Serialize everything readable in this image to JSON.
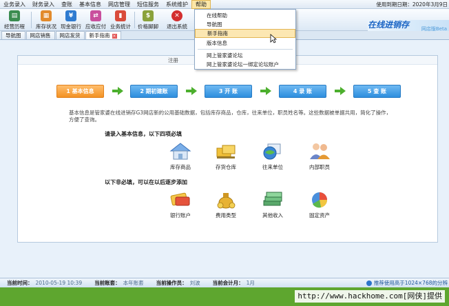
{
  "menu": {
    "items": [
      "业务录入",
      "财务录入",
      "查账",
      "基本信息",
      "网店管理",
      "短信服务",
      "系统维护",
      "帮助"
    ],
    "active_index": 7,
    "expiry": "使用到期日期：2020年3月9日"
  },
  "toolbar": {
    "buttons": [
      {
        "label": "经营历程",
        "icon": "ledger-icon",
        "color": "#3a8c4f"
      },
      {
        "label": "库存状况",
        "icon": "inventory-icon",
        "color": "#e28a2b"
      },
      {
        "label": "现金银行",
        "icon": "cash-icon",
        "color": "#2f7bd0"
      },
      {
        "label": "应收应付",
        "icon": "receivable-icon",
        "color": "#c94f9d"
      },
      {
        "label": "业务统计",
        "icon": "bar-chart-icon",
        "color": "#d94b3b"
      },
      {
        "label": "价格脚脚",
        "icon": "price-icon",
        "color": "#8aa23b"
      },
      {
        "label": "退出系统",
        "icon": "exit-icon",
        "color": "#d32f2f"
      }
    ],
    "brand": "在线进销存G3",
    "brand_sub": "网店版Beta"
  },
  "tabs": {
    "items": [
      "导航图",
      "网店销售",
      "网店发货",
      "新手指南"
    ],
    "active_index": 3
  },
  "help_menu": {
    "items": [
      "在线帮助",
      "导航图",
      "新手指南",
      "版本信息",
      "网上管家婆论坛",
      "网上管家婆论坛一绑定论坛账户"
    ],
    "hover_index": 2
  },
  "guide": {
    "header_text": "注册",
    "steps": [
      "1  基本信息",
      "2  期初建账",
      "3  开  账",
      "4  录  账",
      "5  查  账"
    ],
    "description": "基本信息是管家婆在线进销存G3网店新的公用基础数据，包括库存商品，仓库，往来单位，职员姓名等。这些数据被单据共用，简化了操作，方便了查询。",
    "required_title": "请录入基本信息，以下四项必填",
    "required_items": [
      {
        "label": "库存商品",
        "icon": "house-icon"
      },
      {
        "label": "存货仓库",
        "icon": "warehouse-icon"
      },
      {
        "label": "往来单位",
        "icon": "globe-icon"
      },
      {
        "label": "内部职员",
        "icon": "staff-icon"
      }
    ],
    "optional_title": "以下非必填，可以在以后逐步添加",
    "optional_items": [
      {
        "label": "银行账户",
        "icon": "bank-card-icon"
      },
      {
        "label": "费用类型",
        "icon": "coin-bag-icon"
      },
      {
        "label": "其他收入",
        "icon": "money-stack-icon"
      },
      {
        "label": "固定资产",
        "icon": "pie-chart-icon"
      }
    ]
  },
  "status": {
    "time_label": "当前时间：",
    "time_value": "2010-05-19 10:39",
    "account_label": "当前账套：",
    "account_value": "本年账套",
    "operator_label": "当前操作员：",
    "operator_value": "刘波",
    "period_label": "当前会计月：",
    "period_value": "1月",
    "tip": "推荐使用高于1024×768的分辨"
  },
  "watermark": "http://www.hackhome.com[网侠]提供"
}
